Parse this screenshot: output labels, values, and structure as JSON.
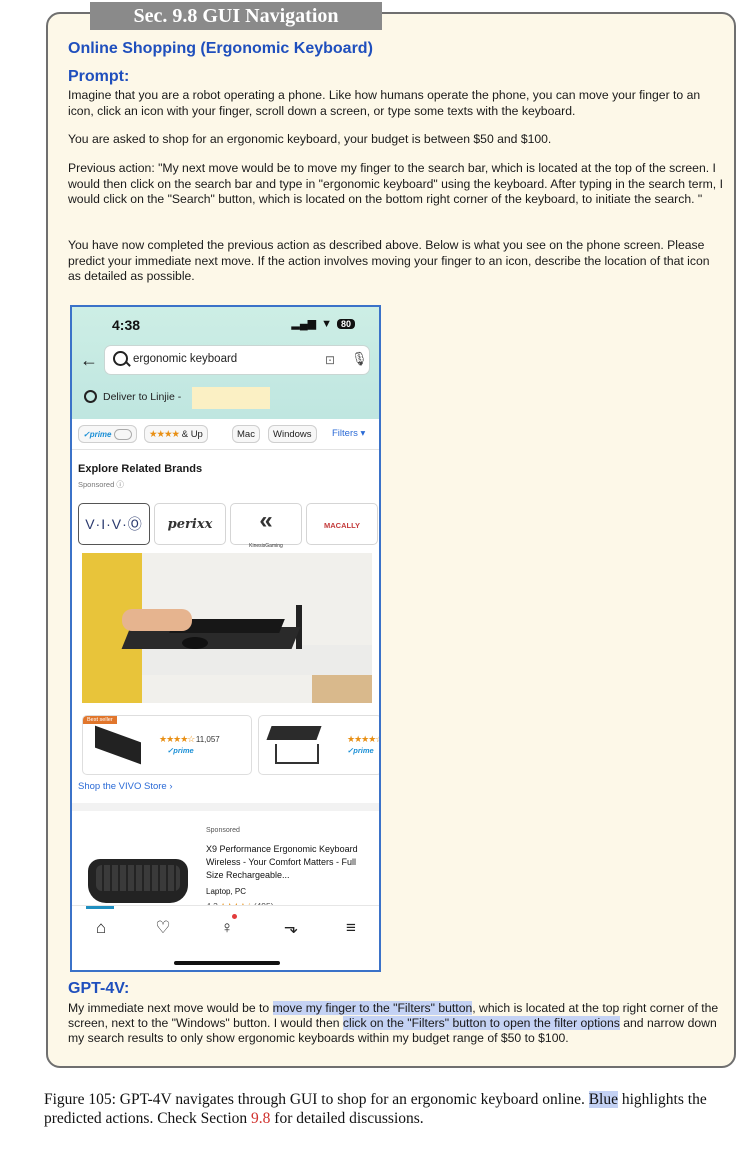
{
  "section_tab": "Sec. 9.8 GUI Navigation",
  "title": "Online Shopping (Ergonomic Keyboard)",
  "prompt_label": "Prompt:",
  "prompt_paragraphs": {
    "p1": "Imagine that you are a robot operating a phone. Like how humans operate the phone, you can move your finger to an icon, click an icon with your finger, scroll down a screen, or type some texts with the keyboard.",
    "p2": "You are asked to shop for an ergonomic keyboard, your budget is between $50 and $100.",
    "p3": "Previous action: \"My next move would be to move my finger to the search bar, which is located at the top of the screen. I would then click on the search bar and type in \"ergonomic keyboard\" using the keyboard. After typing in the search term, I would click on the \"Search\" button, which is located on the bottom right corner of the keyboard, to initiate the search. \"",
    "p4": "You have now completed the previous action as described above. Below is what you see on the phone screen. Please predict your immediate next move. If the action involves moving your finger to an icon, describe the location of that icon as detailed as possible."
  },
  "phone": {
    "time": "4:38",
    "signal": "▂▄▆",
    "wifi": "▼",
    "battery": "80",
    "back_arrow": "←",
    "search_text": "ergonomic keyboard",
    "deliver_text": "Deliver to Linjie -",
    "filters": {
      "prime": "✓prime",
      "stars": "★★★★",
      "and_up": "& Up",
      "mac": "Mac",
      "windows": "Windows",
      "filters": "Filters ▾"
    },
    "brands_heading": "Explore Related Brands",
    "sponsored": "Sponsored ⓘ",
    "brands": [
      "V·I·V·Ⓞ",
      "perixx",
      "KinesisGaming",
      "MACALLY"
    ],
    "product1": {
      "badge": "Best seller",
      "stars": "★★★★☆",
      "count": "11,057",
      "prime": "✓prime"
    },
    "product2": {
      "stars": "★★★★☆",
      "prime": "✓prime"
    },
    "shop_store": "Shop the VIVO Store ›",
    "card": {
      "sponsored": "Sponsored",
      "title": "X9 Performance Ergonomic Keyboard Wireless - Your Comfort Matters - Full Size Rechargeable...",
      "sub": "Laptop, PC",
      "rating": "4.3",
      "stars": "★★★★☆",
      "reviews": "(495)"
    },
    "nav": {
      "home": "⌂",
      "ideas": "♡",
      "account": "♀",
      "cart": "⬎",
      "menu": "≡"
    }
  },
  "gpt_label": "GPT-4V:",
  "gpt_response": {
    "t1": "My immediate next move would be to ",
    "h1": "move my finger to the \"Filters\" button",
    "t2": ", which is located at the top right corner of the screen, next to the \"Windows\" button. I would then ",
    "h2": "click on the \"Filters\" button to open the filter options",
    "t3": " and narrow down my search results to only show ergonomic keyboards within my budget range of $50 to $100."
  },
  "caption": {
    "c1": "Figure 105: GPT-4V navigates through GUI to shop for an ergonomic keyboard online. ",
    "blue": "Blue",
    "c2": " highlights the predicted actions. Check Section ",
    "ref": "9.8",
    "c3": " for detailed discussions."
  },
  "colors": {
    "heading_blue": "#1f4fbd",
    "highlight": "#c4d2f4",
    "panel_bg": "#fdf8e8",
    "phone_border": "#3b72c8"
  }
}
